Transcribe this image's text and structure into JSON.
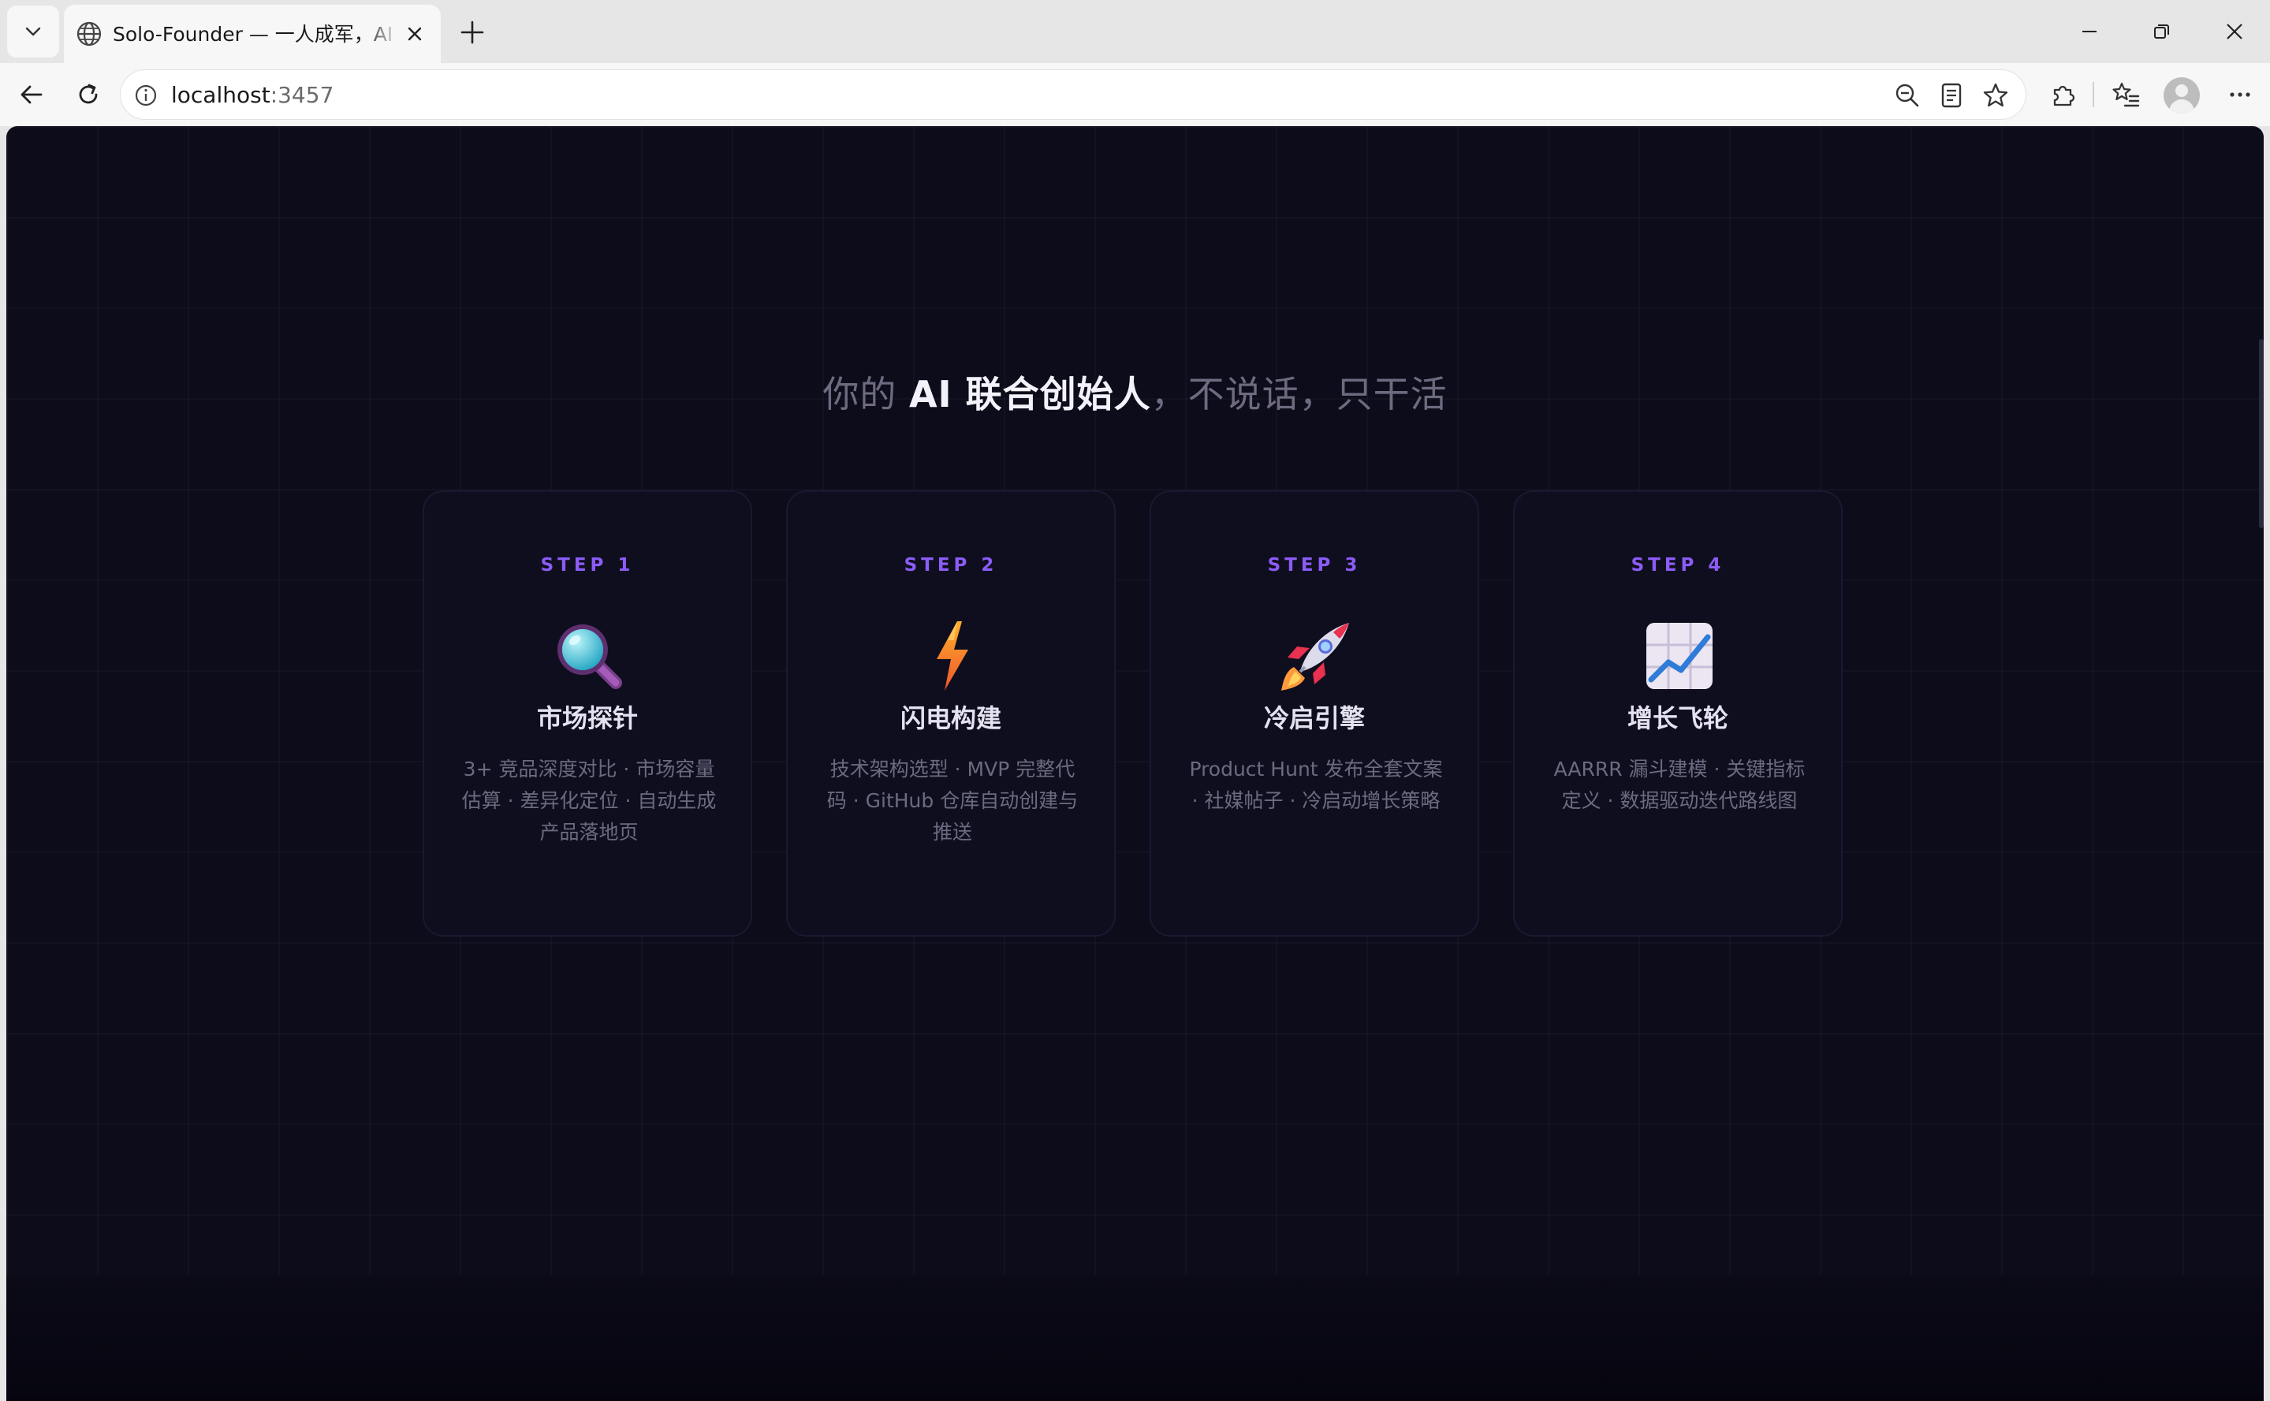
{
  "browser": {
    "tab_title": "Solo-Founder — 一人成军，AI 全栈",
    "url_host": "localhost",
    "url_port": ":3457"
  },
  "page": {
    "headline": {
      "prefix": "你的 ",
      "emphasis": "AI 联合创始人",
      "suffix": "，不说话，只干活"
    },
    "steps": [
      {
        "label": "STEP 1",
        "icon": "magnifying-glass-icon",
        "title": "市场探针",
        "desc": "3+ 竞品深度对比 · 市场容量估算 · 差异化定位 · 自动生成产品落地页"
      },
      {
        "label": "STEP 2",
        "icon": "lightning-icon",
        "title": "闪电构建",
        "desc": "技术架构选型 · MVP 完整代码 · GitHub 仓库自动创建与推送"
      },
      {
        "label": "STEP 3",
        "icon": "rocket-icon",
        "title": "冷启引擎",
        "desc": "Product Hunt 发布全套文案 · 社媒帖子 · 冷启动增长策略"
      },
      {
        "label": "STEP 4",
        "icon": "chart-increasing-icon",
        "title": "增长飞轮",
        "desc": "AARRR 漏斗建模 · 关键指标定义 · 数据驱动迭代路线图"
      }
    ]
  },
  "colors": {
    "background": "#0d0c1b",
    "accent": "#8b5cf6",
    "card_border": "#1a1930"
  }
}
